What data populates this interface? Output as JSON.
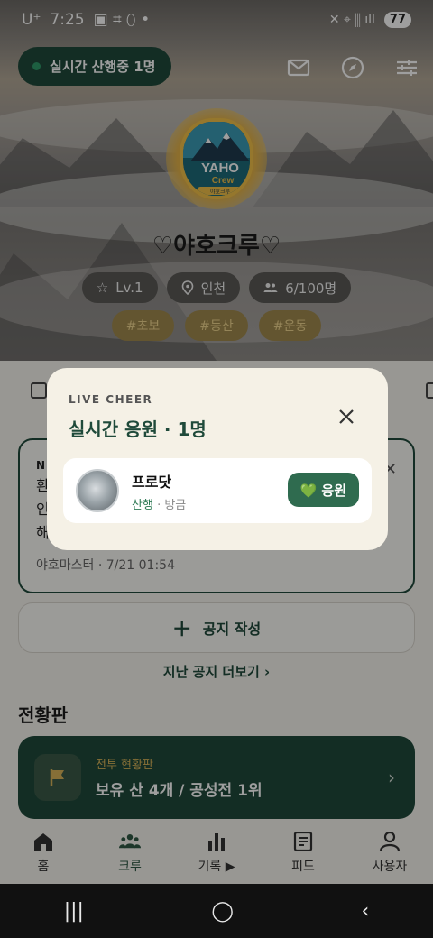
{
  "status_bar": {
    "carrier": "U⁺",
    "time": "7:25",
    "battery": "77"
  },
  "hero": {
    "live_pill": "실시간 산행중 1명",
    "crew_name": "♡야호크루♡",
    "chips": [
      {
        "icon": "star-icon",
        "label": "Lv.1"
      },
      {
        "icon": "location-pin-icon",
        "label": "인천"
      },
      {
        "icon": "people-icon",
        "label": "6/100명"
      }
    ],
    "tags": [
      "#초보",
      "#등산",
      "#운동"
    ],
    "logo": {
      "top": "YAHO",
      "bottom": "Crew",
      "band": "야호크루"
    }
  },
  "notice": {
    "label": "N",
    "preview_lines": [
      "환",
      "인",
      "해"
    ],
    "meta": "야호마스터 · 7/21 01:54"
  },
  "write_notice": "공지 작성",
  "more_notices": "지난 공지 더보기 ›",
  "board": {
    "section_title": "전황판",
    "sub": "전투 현황판",
    "main": "보유 산 4개 / 공성전 1위"
  },
  "modal": {
    "eyebrow": "LIVE CHEER",
    "title": "실시간 응원 · 1명",
    "members": [
      {
        "name": "프로닷",
        "activity": "산행",
        "time": "방금",
        "cheer_label": "💚 응원"
      }
    ]
  },
  "bottom_nav": [
    {
      "label": "홈",
      "icon": "home-icon"
    },
    {
      "label": "크루",
      "icon": "crew-icon"
    },
    {
      "label": "기록 ▶",
      "icon": "chart-icon"
    },
    {
      "label": "피드",
      "icon": "feed-icon"
    },
    {
      "label": "사용자",
      "icon": "user-icon"
    }
  ],
  "colors": {
    "primary": "#1f4a3a",
    "accent": "#2f6b4f",
    "gold": "#e2b24a"
  }
}
